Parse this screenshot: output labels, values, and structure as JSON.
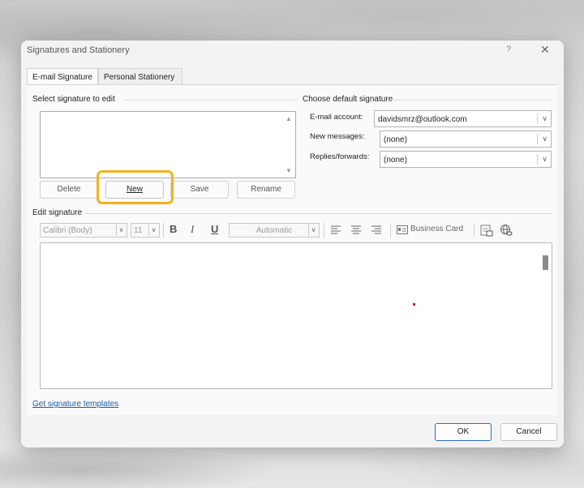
{
  "dialog": {
    "title": "Signatures and Stationery",
    "help_glyph": "?",
    "close_glyph": "✕"
  },
  "tabs": [
    {
      "label": "E-mail Signature",
      "active": true
    },
    {
      "label": "Personal Stationery",
      "active": false
    }
  ],
  "select_signature": {
    "label": "Select signature to edit",
    "items": [],
    "buttons": {
      "delete": "Delete",
      "new": "New",
      "save": "Save",
      "rename": "Rename"
    }
  },
  "default_signature": {
    "label": "Choose default signature",
    "email_account_label": "E-mail account:",
    "email_account_value": "davidsmrz@outlook.com",
    "new_messages_label": "New messages:",
    "new_messages_value": "(none)",
    "replies_label": "Replies/forwards:",
    "replies_value": "(none)"
  },
  "edit_signature": {
    "label": "Edit signature",
    "font": "Calibri (Body)",
    "size": "11",
    "bold": "B",
    "italic": "I",
    "underline": "U",
    "color": "Automatic",
    "business_card": "Business Card",
    "icons": [
      "align-left-icon",
      "align-center-icon",
      "align-right-icon",
      "business-card-icon",
      "insert-picture-icon",
      "hyperlink-icon"
    ]
  },
  "templates_link": "Get signature templates",
  "footer": {
    "ok": "OK",
    "cancel": "Cancel"
  },
  "colors": {
    "highlight": "#f3b21c",
    "link": "#1a5aa8",
    "ok_border": "#2b6cc4"
  }
}
